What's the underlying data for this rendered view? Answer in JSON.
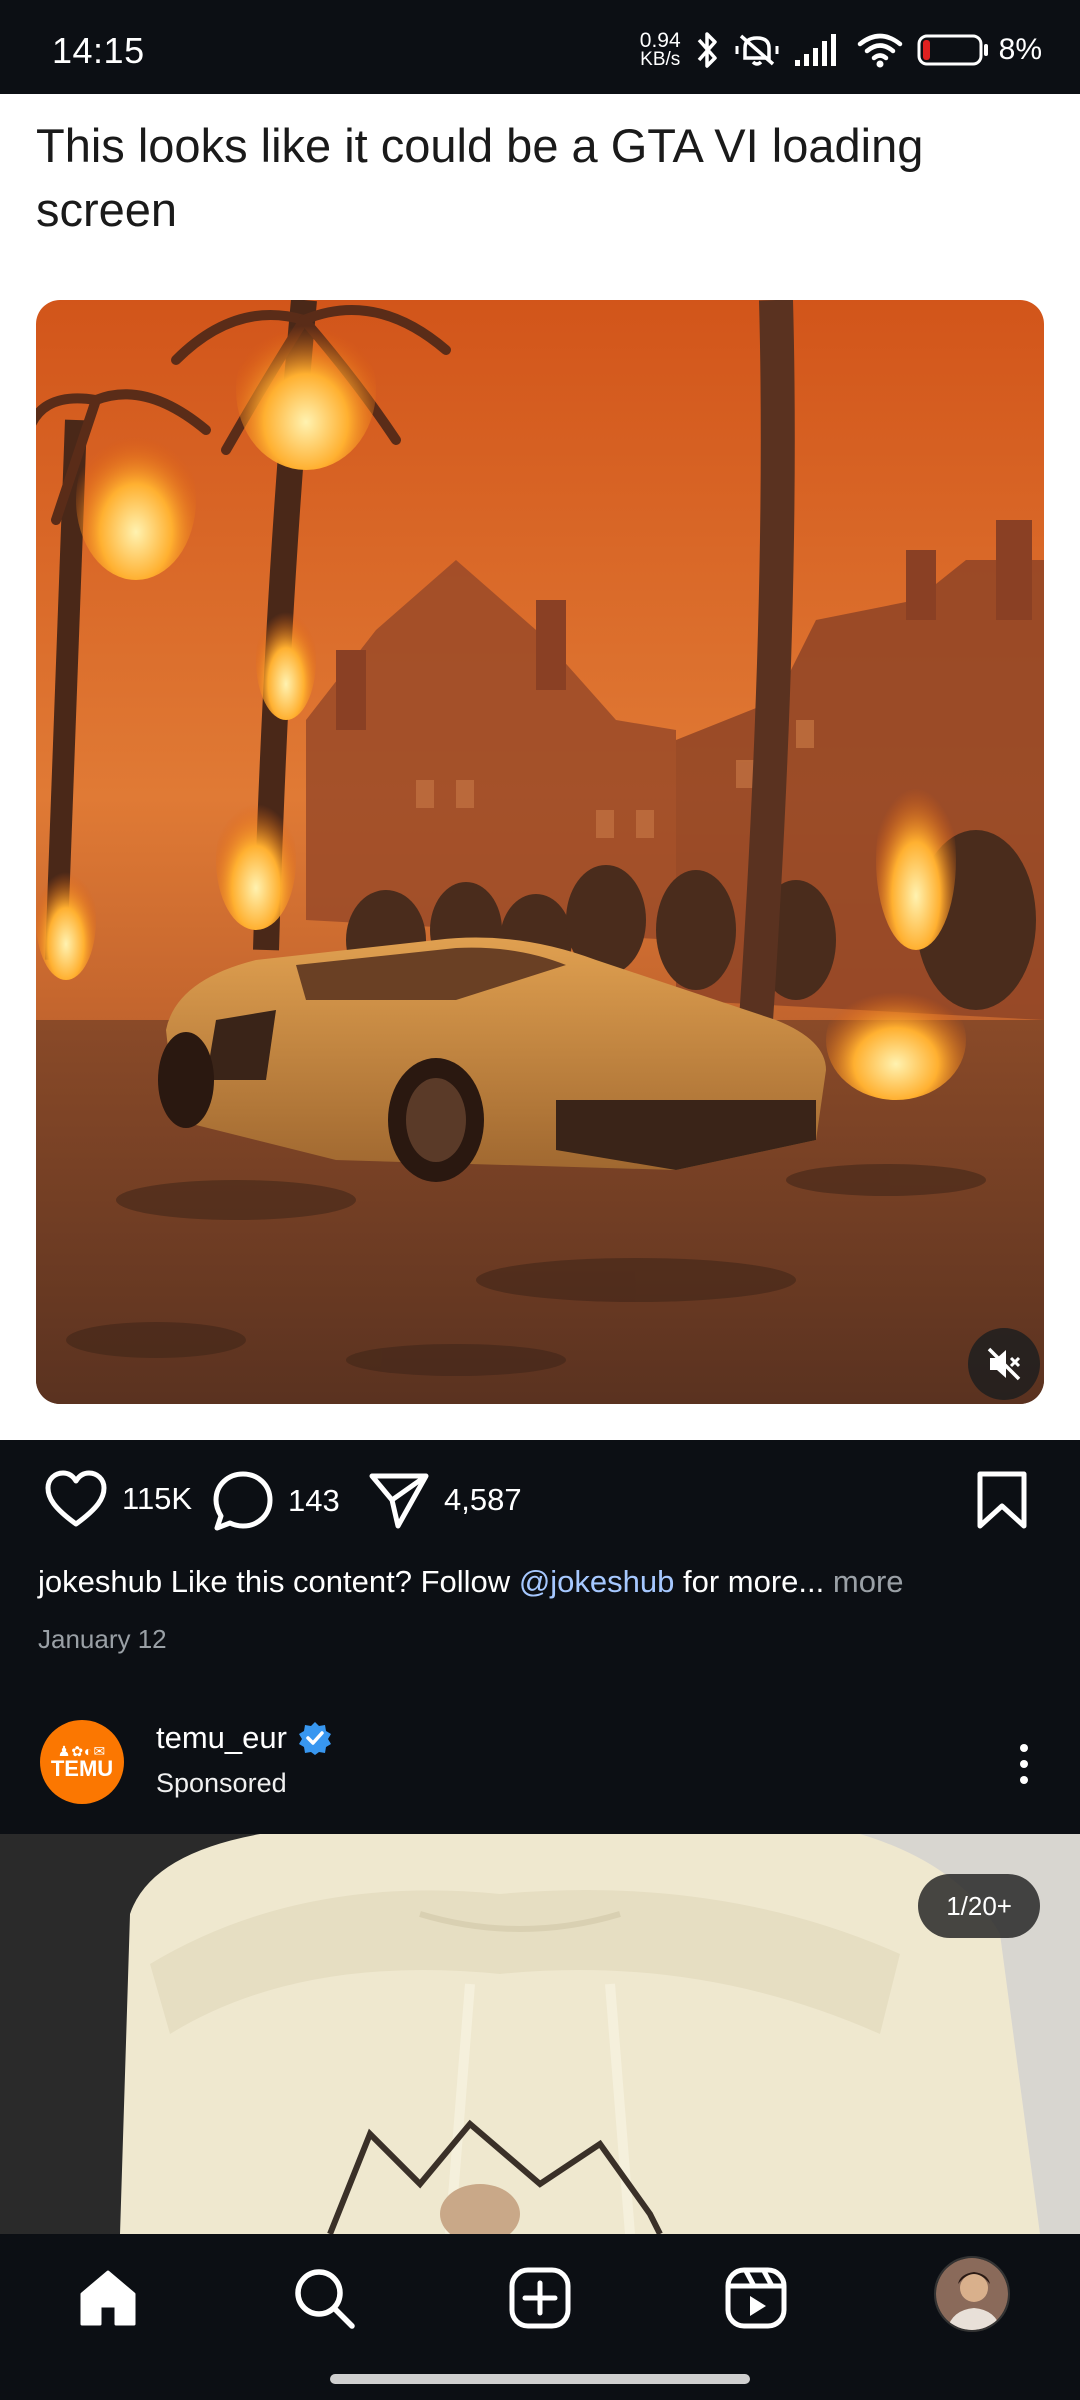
{
  "status_bar": {
    "time": "14:15",
    "net_speed_value": "0.94",
    "net_speed_unit": "KB/s",
    "battery_percent": "8%",
    "icons": [
      "bluetooth-icon",
      "mute-vibrate-icon",
      "signal-icon",
      "wifi-icon",
      "battery-icon"
    ]
  },
  "post": {
    "title": "This looks like it could be a GTA VI loading screen",
    "like_count": "115K",
    "comment_count": "143",
    "share_count": "4,587",
    "caption_user": "jokeshub",
    "caption_text": "Like this content? Follow",
    "caption_mention": "@jokeshub",
    "caption_tail": "for more...",
    "caption_more": "more",
    "date": "January 12"
  },
  "sponsored": {
    "avatar_brand": "TEMU",
    "avatar_glyphs": "♟✿◐✉",
    "username": "temu_eur",
    "verified": true,
    "subtitle": "Sponsored",
    "carousel_counter": "1/20+"
  },
  "nav": {
    "items": [
      "home-icon",
      "search-icon",
      "create-icon",
      "reels-icon",
      "profile-avatar"
    ]
  },
  "colors": {
    "background": "#0c0f14",
    "mention": "#a6c8ff",
    "verified": "#3897f0",
    "temu_orange": "#fb7701"
  }
}
